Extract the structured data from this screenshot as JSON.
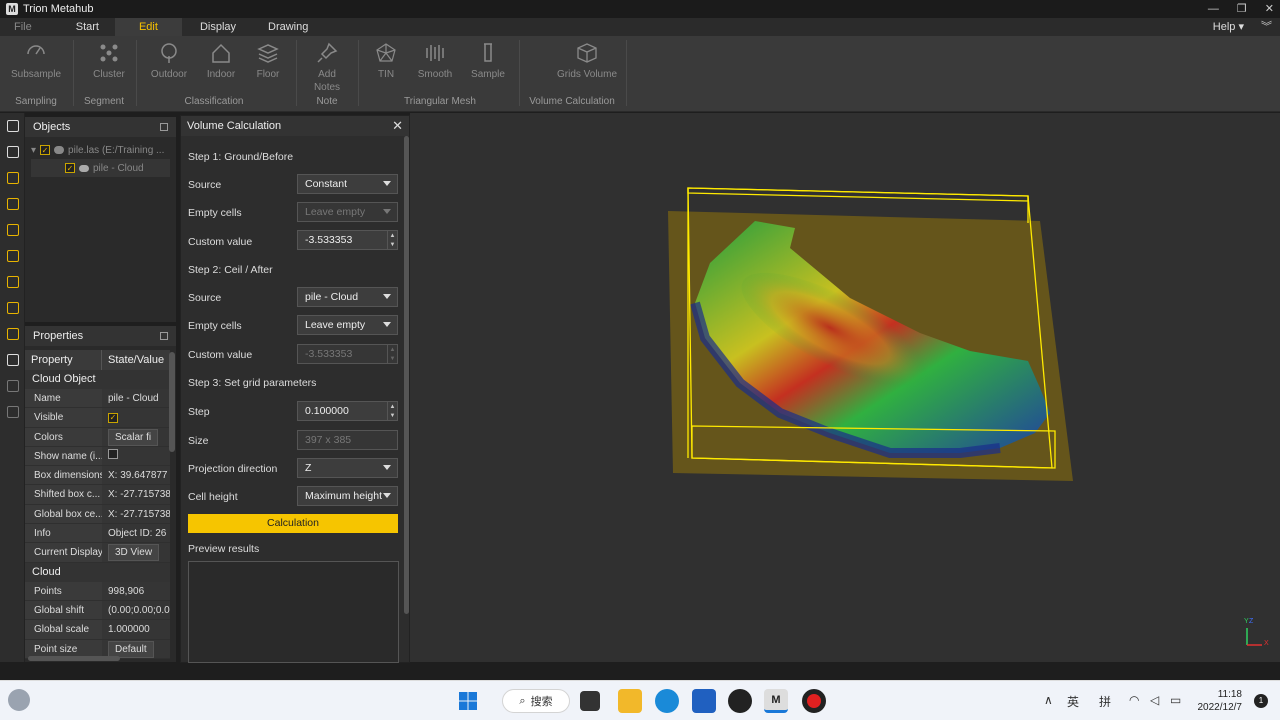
{
  "app": {
    "title": "Trion Metahub"
  },
  "menu": {
    "file": "File",
    "start": "Start",
    "edit": "Edit",
    "display": "Display",
    "drawing": "Drawing",
    "help": "Help"
  },
  "ribbon": {
    "subsample": "Subsample",
    "cluster": "Cluster",
    "outdoor": "Outdoor",
    "indoor": "Indoor",
    "floor": "Floor",
    "add": "Add",
    "notes": "Notes",
    "tin": "TIN",
    "smooth": "Smooth",
    "sample": "Sample",
    "grids_volume": "Grids Volume",
    "groups": {
      "sampling": "Sampling",
      "segment": "Segment",
      "classification": "Classification",
      "note": "Note",
      "mesh": "Triangular Mesh",
      "volume": "Volume Calculation"
    }
  },
  "objects": {
    "title": "Objects",
    "root": "pile.las (E:/Training ...",
    "child": "pile - Cloud"
  },
  "properties": {
    "title": "Properties",
    "col_property": "Property",
    "col_value": "State/Value",
    "sec_cloud_object": "Cloud Object",
    "rows1": [
      {
        "k": "Name",
        "v": "pile - Cloud"
      },
      {
        "k": "Visible",
        "v": ""
      },
      {
        "k": "Colors",
        "v": "Scalar fi"
      },
      {
        "k": "Show name (i...",
        "v": ""
      },
      {
        "k": "Box dimensions",
        "v": "X: 39.647877"
      },
      {
        "k": "Shifted box c...",
        "v": "X: -27.715738"
      },
      {
        "k": "Global box ce...",
        "v": "X: -27.715738"
      },
      {
        "k": "Info",
        "v": "Object ID: 26"
      },
      {
        "k": "Current Display",
        "v": "3D View"
      }
    ],
    "sec_cloud": "Cloud",
    "rows2": [
      {
        "k": "Points",
        "v": "998,906"
      },
      {
        "k": "Global shift",
        "v": "(0.00;0.00;0.0"
      },
      {
        "k": "Global scale",
        "v": "1.000000"
      },
      {
        "k": "Point size",
        "v": "Default"
      }
    ]
  },
  "dialog": {
    "title": "Volume Calculation",
    "step1": "Step 1: Ground/Before",
    "step2": "Step 2: Ceil / After",
    "step3": "Step 3: Set grid parameters",
    "source_label": "Source",
    "empty_label": "Empty cells",
    "custom_label": "Custom value",
    "s1_source": "Constant",
    "s1_empty": "Leave empty",
    "s1_custom": "-3.533353",
    "s2_source": "pile - Cloud",
    "s2_empty": "Leave empty",
    "s2_custom": "-3.533353",
    "step_label": "Step",
    "step_value": "0.100000",
    "size_label": "Size",
    "size_value": "397 x 385",
    "proj_label": "Projection direction",
    "proj_value": "Z",
    "cell_label": "Cell height",
    "cell_value": "Maximum height",
    "calc_button": "Calculation",
    "preview_label": "Preview results"
  },
  "viewport": {
    "axis_y": "Y",
    "axis_z": "Z",
    "axis_x": "X"
  },
  "taskbar": {
    "search": "搜索",
    "ime1": "英",
    "ime2": "拼",
    "time": "11:18",
    "date": "2022/12/7",
    "notif": "1"
  }
}
